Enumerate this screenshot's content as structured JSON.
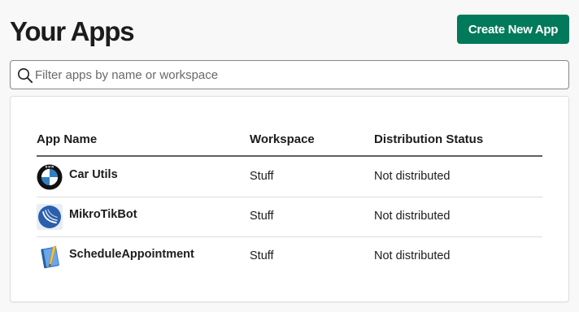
{
  "header": {
    "title": "Your Apps",
    "create_button_label": "Create New App"
  },
  "search": {
    "placeholder": "Filter apps by name or workspace",
    "value": "",
    "icon": "search-icon"
  },
  "table": {
    "columns": [
      "App Name",
      "Workspace",
      "Distribution Status"
    ],
    "rows": [
      {
        "name": "Car Utils",
        "workspace": "Stuff",
        "status": "Not distributed",
        "icon": "bmw-logo-icon"
      },
      {
        "name": "MikroTikBot",
        "workspace": "Stuff",
        "status": "Not distributed",
        "icon": "mikrotik-logo-icon"
      },
      {
        "name": "ScheduleAppointment",
        "workspace": "Stuff",
        "status": "Not distributed",
        "icon": "notebook-icon"
      }
    ]
  },
  "colors": {
    "primary_button": "#007a5a",
    "background": "#f8f8f8",
    "text": "#1d1c1d"
  }
}
